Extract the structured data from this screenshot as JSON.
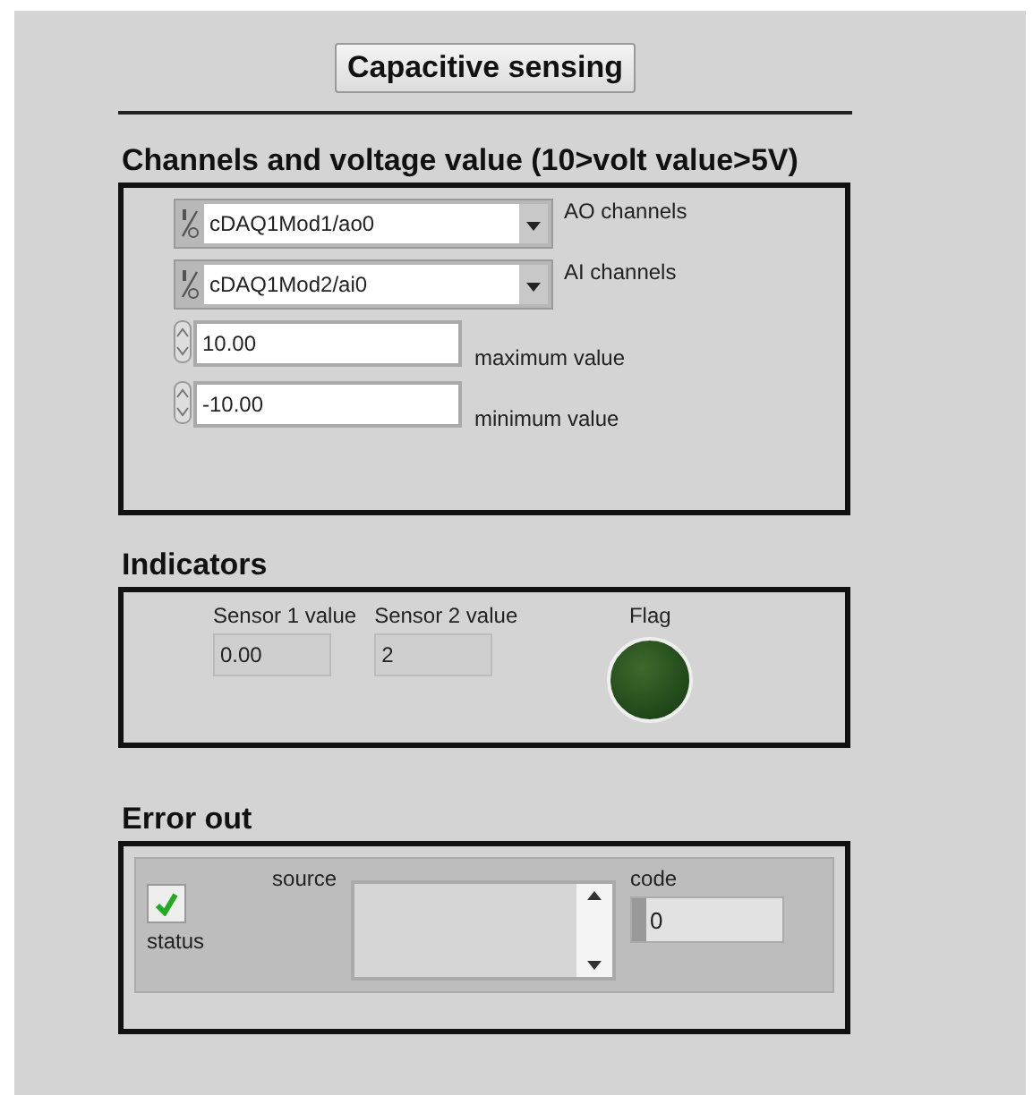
{
  "title_button": "Capacitive sensing",
  "channels_section": {
    "heading": "Channels and voltage value (10>volt value>5V)",
    "channel_selectors": [
      {
        "value": "cDAQ1Mod1/ao0",
        "label": "AO channels"
      },
      {
        "value": "cDAQ1Mod2/ai0",
        "label": "AI channels"
      }
    ],
    "numeric_controls": [
      {
        "value": "10.00",
        "label": "maximum value"
      },
      {
        "value": "-10.00",
        "label": "minimum value"
      }
    ]
  },
  "indicators": {
    "heading": "Indicators",
    "values": [
      {
        "label": "Sensor 1 value",
        "value": "0.00"
      },
      {
        "label": "Sensor 2 value",
        "value": "2"
      }
    ],
    "flag": {
      "label": "Flag",
      "on": false
    }
  },
  "error_out": {
    "heading": "Error out",
    "status": {
      "label": "status",
      "checked": true
    },
    "source": {
      "label": "source"
    },
    "code": {
      "label": "code",
      "value": "0"
    }
  }
}
